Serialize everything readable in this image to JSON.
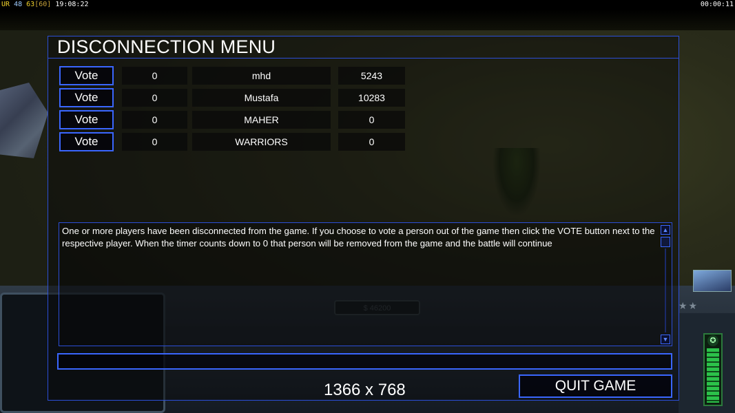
{
  "status_bar": {
    "ur_label": "UR",
    "stat_a": "48",
    "stat_b": "63",
    "fps": "[60]",
    "clock": "19:08:22",
    "elapsed": "00:00:11"
  },
  "hud": {
    "money": "$ 46200"
  },
  "dialog": {
    "title": "DISCONNECTION MENU",
    "players": [
      {
        "vote_label": "Vote",
        "timer": "0",
        "name": "mhd",
        "ping": "5243"
      },
      {
        "vote_label": "Vote",
        "timer": "0",
        "name": "Mustafa",
        "ping": "10283"
      },
      {
        "vote_label": "Vote",
        "timer": "0",
        "name": "MAHER",
        "ping": "0"
      },
      {
        "vote_label": "Vote",
        "timer": "0",
        "name": "WARRIORS",
        "ping": "0"
      }
    ],
    "message": "One or more players have been disconnected from the game. If you choose to vote a person out of the game then click the VOTE button next to the respective player. When the timer counts down to 0 that person will be removed from the game and the battle will continue",
    "chat_input_value": "",
    "resolution": "1366 x 768",
    "quit_label": "QUIT GAME"
  },
  "icons": {
    "scroll_up": "scroll-up-arrow-icon",
    "scroll_down": "scroll-down-arrow-icon"
  },
  "colors": {
    "accent_border": "#3a66ff",
    "dialog_border": "#2c4fd8",
    "text": "#ffffff"
  }
}
